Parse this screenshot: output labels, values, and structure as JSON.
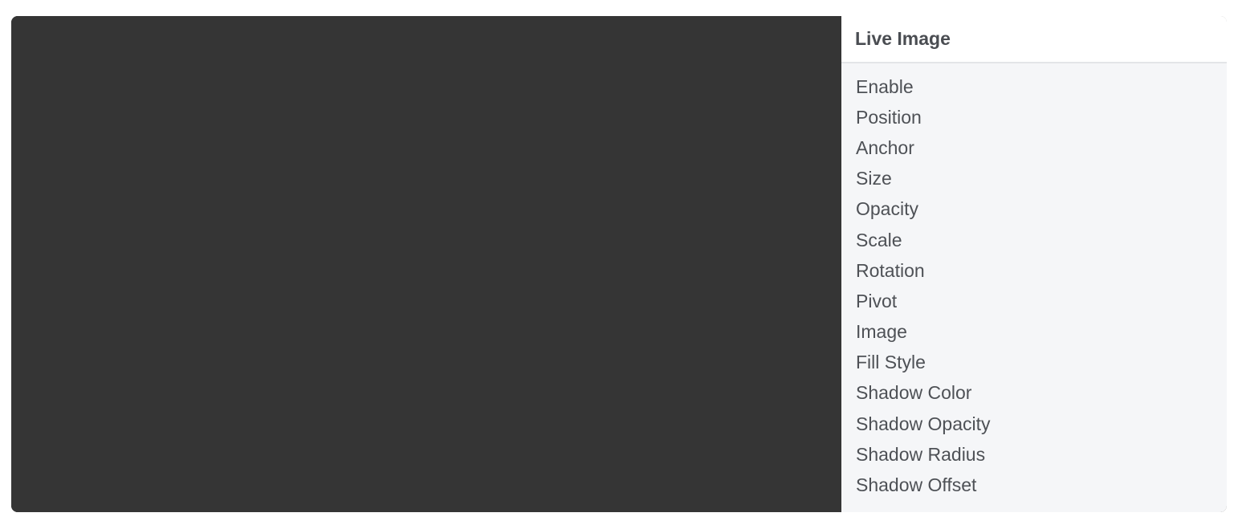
{
  "panel": {
    "title": "Live Image",
    "properties": [
      "Enable",
      "Position",
      "Anchor",
      "Size",
      "Opacity",
      "Scale",
      "Rotation",
      "Pivot",
      "Image",
      "Fill Style",
      "Shadow Color",
      "Shadow Opacity",
      "Shadow Radius",
      "Shadow Offset"
    ]
  },
  "colors": {
    "viewport_background": "#353535",
    "panel_background": "#f5f6f8",
    "header_background": "#ffffff",
    "text": "#4e5156"
  }
}
